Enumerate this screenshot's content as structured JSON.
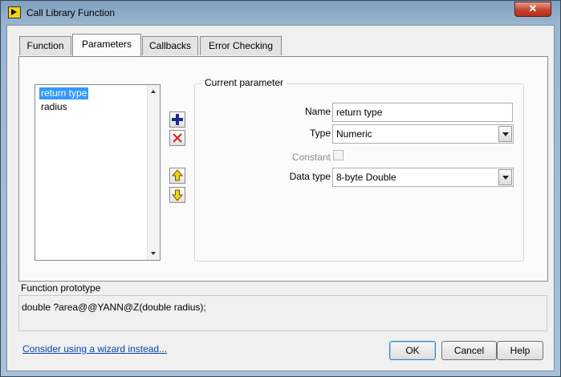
{
  "window": {
    "title": "Call Library Function",
    "close_glyph": "✕"
  },
  "tabs": [
    {
      "label": "Function"
    },
    {
      "label": "Parameters"
    },
    {
      "label": "Callbacks"
    },
    {
      "label": "Error Checking"
    }
  ],
  "active_tab": "Parameters",
  "parameter_list": {
    "items": [
      {
        "label": "return type",
        "selected": true
      },
      {
        "label": "radius",
        "selected": false
      }
    ]
  },
  "side_buttons": {
    "add_icon": "plus-icon",
    "delete_icon": "red-x-icon",
    "move_up_icon": "arrow-up-icon",
    "move_down_icon": "arrow-down-icon"
  },
  "current_parameter": {
    "group_title": "Current parameter",
    "name_label": "Name",
    "name_value": "return type",
    "type_label": "Type",
    "type_value": "Numeric",
    "constant_label": "Constant",
    "constant_checked": false,
    "data_type_label": "Data type",
    "data_type_value": "8-byte Double"
  },
  "prototype": {
    "label": "Function prototype",
    "value": "double ?area@@YANN@Z(double radius);"
  },
  "footer": {
    "wizard_link": "Consider using a wizard instead...",
    "ok_label": "OK",
    "cancel_label": "Cancel",
    "help_label": "Help"
  },
  "colors": {
    "selection": "#3399ff",
    "link": "#0645ad",
    "add_icon": "#1b2a8a",
    "delete_icon": "#d42020",
    "arrow_icon": "#d9b400"
  }
}
